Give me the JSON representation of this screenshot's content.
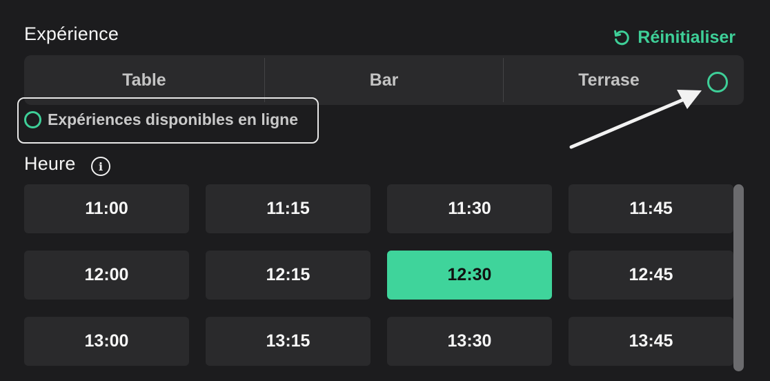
{
  "colors": {
    "accent": "#3ecf98",
    "background": "#1c1c1e",
    "tile": "#2a2a2c"
  },
  "experience": {
    "title": "Expérience",
    "reset_label": "Réinitialiser",
    "reset_icon": "refresh-icon",
    "segments": [
      {
        "label": "Table"
      },
      {
        "label": "Bar"
      },
      {
        "label": "Terrase"
      }
    ],
    "available_online_label": "Expériences disponibles en ligne",
    "available_icon": "radio-dot-icon"
  },
  "hours": {
    "title": "Heure",
    "info_icon": "info-icon",
    "slots": [
      {
        "label": "11:00",
        "selected": false
      },
      {
        "label": "11:15",
        "selected": false
      },
      {
        "label": "11:30",
        "selected": false
      },
      {
        "label": "11:45",
        "selected": false
      },
      {
        "label": "12:00",
        "selected": false
      },
      {
        "label": "12:15",
        "selected": false
      },
      {
        "label": "12:30",
        "selected": true
      },
      {
        "label": "12:45",
        "selected": false
      },
      {
        "label": "13:00",
        "selected": false
      },
      {
        "label": "13:15",
        "selected": false
      },
      {
        "label": "13:30",
        "selected": false
      },
      {
        "label": "13:45",
        "selected": false
      }
    ]
  }
}
